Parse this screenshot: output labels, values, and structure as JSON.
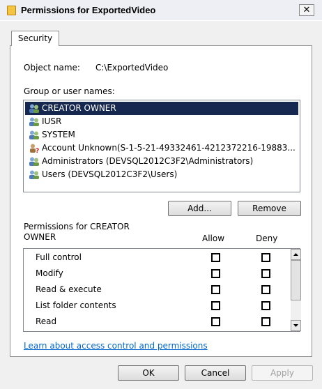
{
  "window": {
    "title": "Permissions for ExportedVideo",
    "close_glyph": "✕"
  },
  "tabs": [
    {
      "label": "Security"
    }
  ],
  "object": {
    "label": "Object name:",
    "value": "C:\\ExportedVideo"
  },
  "groups": {
    "label": "Group or user names:",
    "items": [
      {
        "label": "CREATOR OWNER",
        "icon": "users-group-icon",
        "selected": true
      },
      {
        "label": "IUSR",
        "icon": "users-group-icon"
      },
      {
        "label": "SYSTEM",
        "icon": "users-group-icon"
      },
      {
        "label": "Account Unknown(S-1-5-21-49332461-4212372216-19883...",
        "icon": "unknown-account-icon"
      },
      {
        "label": "Administrators (DEVSQL2012C3F2\\Administrators)",
        "icon": "users-group-icon"
      },
      {
        "label": "Users (DEVSQL2012C3F2\\Users)",
        "icon": "users-group-icon"
      }
    ],
    "add_label": "Add...",
    "remove_label": "Remove"
  },
  "permissions": {
    "label_line1": "Permissions for CREATOR",
    "label_line2": "OWNER",
    "allow_label": "Allow",
    "deny_label": "Deny",
    "rows": [
      {
        "name": "Full control",
        "allow": false,
        "deny": false
      },
      {
        "name": "Modify",
        "allow": false,
        "deny": false
      },
      {
        "name": "Read & execute",
        "allow": false,
        "deny": false
      },
      {
        "name": "List folder contents",
        "allow": false,
        "deny": false
      },
      {
        "name": "Read",
        "allow": false,
        "deny": false
      }
    ]
  },
  "link": {
    "label": "Learn about access control and permissions"
  },
  "buttons": {
    "ok": "OK",
    "cancel": "Cancel",
    "apply": "Apply"
  },
  "colors": {
    "selection": "#16284f",
    "link": "#0066cc"
  }
}
